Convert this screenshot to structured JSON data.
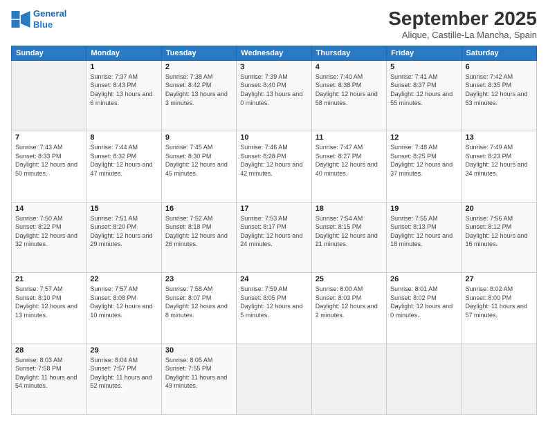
{
  "logo": {
    "line1": "General",
    "line2": "Blue"
  },
  "header": {
    "title": "September 2025",
    "location": "Alique, Castille-La Mancha, Spain"
  },
  "weekdays": [
    "Sunday",
    "Monday",
    "Tuesday",
    "Wednesday",
    "Thursday",
    "Friday",
    "Saturday"
  ],
  "weeks": [
    [
      {
        "day": null,
        "info": null
      },
      {
        "day": "1",
        "sunrise": "7:37 AM",
        "sunset": "8:43 PM",
        "daylight": "13 hours and 6 minutes."
      },
      {
        "day": "2",
        "sunrise": "7:38 AM",
        "sunset": "8:42 PM",
        "daylight": "13 hours and 3 minutes."
      },
      {
        "day": "3",
        "sunrise": "7:39 AM",
        "sunset": "8:40 PM",
        "daylight": "13 hours and 0 minutes."
      },
      {
        "day": "4",
        "sunrise": "7:40 AM",
        "sunset": "8:38 PM",
        "daylight": "12 hours and 58 minutes."
      },
      {
        "day": "5",
        "sunrise": "7:41 AM",
        "sunset": "8:37 PM",
        "daylight": "12 hours and 55 minutes."
      },
      {
        "day": "6",
        "sunrise": "7:42 AM",
        "sunset": "8:35 PM",
        "daylight": "12 hours and 53 minutes."
      }
    ],
    [
      {
        "day": "7",
        "sunrise": "7:43 AM",
        "sunset": "8:33 PM",
        "daylight": "12 hours and 50 minutes."
      },
      {
        "day": "8",
        "sunrise": "7:44 AM",
        "sunset": "8:32 PM",
        "daylight": "12 hours and 47 minutes."
      },
      {
        "day": "9",
        "sunrise": "7:45 AM",
        "sunset": "8:30 PM",
        "daylight": "12 hours and 45 minutes."
      },
      {
        "day": "10",
        "sunrise": "7:46 AM",
        "sunset": "8:28 PM",
        "daylight": "12 hours and 42 minutes."
      },
      {
        "day": "11",
        "sunrise": "7:47 AM",
        "sunset": "8:27 PM",
        "daylight": "12 hours and 40 minutes."
      },
      {
        "day": "12",
        "sunrise": "7:48 AM",
        "sunset": "8:25 PM",
        "daylight": "12 hours and 37 minutes."
      },
      {
        "day": "13",
        "sunrise": "7:49 AM",
        "sunset": "8:23 PM",
        "daylight": "12 hours and 34 minutes."
      }
    ],
    [
      {
        "day": "14",
        "sunrise": "7:50 AM",
        "sunset": "8:22 PM",
        "daylight": "12 hours and 32 minutes."
      },
      {
        "day": "15",
        "sunrise": "7:51 AM",
        "sunset": "8:20 PM",
        "daylight": "12 hours and 29 minutes."
      },
      {
        "day": "16",
        "sunrise": "7:52 AM",
        "sunset": "8:18 PM",
        "daylight": "12 hours and 26 minutes."
      },
      {
        "day": "17",
        "sunrise": "7:53 AM",
        "sunset": "8:17 PM",
        "daylight": "12 hours and 24 minutes."
      },
      {
        "day": "18",
        "sunrise": "7:54 AM",
        "sunset": "8:15 PM",
        "daylight": "12 hours and 21 minutes."
      },
      {
        "day": "19",
        "sunrise": "7:55 AM",
        "sunset": "8:13 PM",
        "daylight": "12 hours and 18 minutes."
      },
      {
        "day": "20",
        "sunrise": "7:56 AM",
        "sunset": "8:12 PM",
        "daylight": "12 hours and 16 minutes."
      }
    ],
    [
      {
        "day": "21",
        "sunrise": "7:57 AM",
        "sunset": "8:10 PM",
        "daylight": "12 hours and 13 minutes."
      },
      {
        "day": "22",
        "sunrise": "7:57 AM",
        "sunset": "8:08 PM",
        "daylight": "12 hours and 10 minutes."
      },
      {
        "day": "23",
        "sunrise": "7:58 AM",
        "sunset": "8:07 PM",
        "daylight": "12 hours and 8 minutes."
      },
      {
        "day": "24",
        "sunrise": "7:59 AM",
        "sunset": "8:05 PM",
        "daylight": "12 hours and 5 minutes."
      },
      {
        "day": "25",
        "sunrise": "8:00 AM",
        "sunset": "8:03 PM",
        "daylight": "12 hours and 2 minutes."
      },
      {
        "day": "26",
        "sunrise": "8:01 AM",
        "sunset": "8:02 PM",
        "daylight": "12 hours and 0 minutes."
      },
      {
        "day": "27",
        "sunrise": "8:02 AM",
        "sunset": "8:00 PM",
        "daylight": "11 hours and 57 minutes."
      }
    ],
    [
      {
        "day": "28",
        "sunrise": "8:03 AM",
        "sunset": "7:58 PM",
        "daylight": "11 hours and 54 minutes."
      },
      {
        "day": "29",
        "sunrise": "8:04 AM",
        "sunset": "7:57 PM",
        "daylight": "11 hours and 52 minutes."
      },
      {
        "day": "30",
        "sunrise": "8:05 AM",
        "sunset": "7:55 PM",
        "daylight": "11 hours and 49 minutes."
      },
      {
        "day": null,
        "info": null
      },
      {
        "day": null,
        "info": null
      },
      {
        "day": null,
        "info": null
      },
      {
        "day": null,
        "info": null
      }
    ]
  ]
}
